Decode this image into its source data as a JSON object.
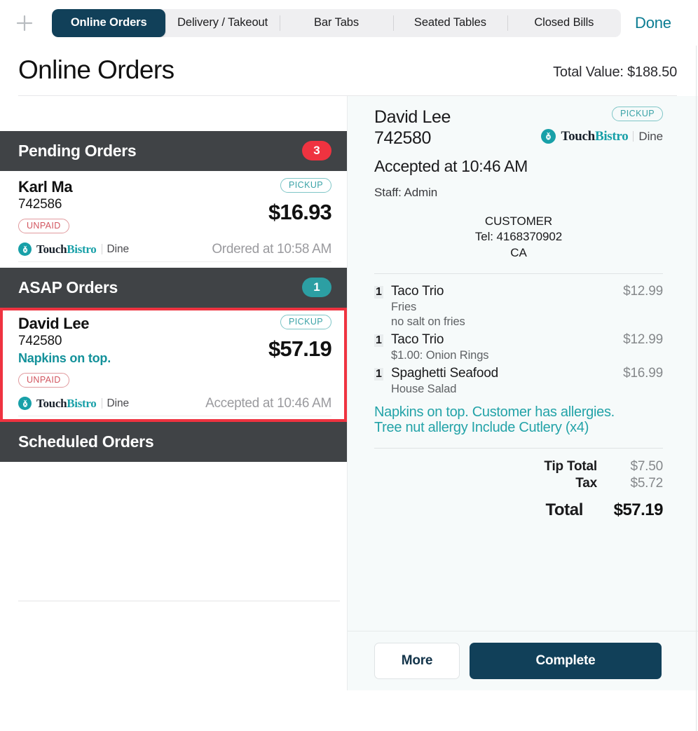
{
  "topbar": {
    "add_icon": "plus-icon",
    "tabs": [
      {
        "label": "Online Orders",
        "active": true
      },
      {
        "label": "Delivery / Takeout",
        "active": false
      },
      {
        "label": "Bar Tabs",
        "active": false
      },
      {
        "label": "Seated Tables",
        "active": false
      },
      {
        "label": "Closed Bills",
        "active": false
      }
    ],
    "done_label": "Done"
  },
  "header": {
    "title": "Online Orders",
    "total_value": "Total Value: $188.50"
  },
  "colors": {
    "accent_navy": "#114059",
    "accent_teal": "#13919a",
    "badge_red": "#ef3340",
    "badge_teal": "#2c9fa3",
    "group_header_bg": "#404346",
    "selection_outline": "#ef3340"
  },
  "left_panel": {
    "groups": [
      {
        "title": "Pending Orders",
        "count": "3",
        "badge_color": "#ef3340",
        "orders": [
          {
            "name": "Karl Ma",
            "number": "742586",
            "note": "",
            "type_badge": "PICKUP",
            "payment_badge": "UNPAID",
            "amount": "$16.93",
            "time": "Ordered at 10:58 AM",
            "brand_word_1": "Touch",
            "brand_word_2": "Bistro",
            "brand_sub": "Dine",
            "selected": false
          }
        ]
      },
      {
        "title": "ASAP Orders",
        "count": "1",
        "badge_color": "#2c9fa3",
        "orders": [
          {
            "name": "David Lee",
            "number": "742580",
            "note": "Napkins on top.",
            "type_badge": "PICKUP",
            "payment_badge": "UNPAID",
            "amount": "$57.19",
            "time": "Accepted at 10:46 AM",
            "brand_word_1": "Touch",
            "brand_word_2": "Bistro",
            "brand_sub": "Dine",
            "selected": true
          }
        ]
      },
      {
        "title": "Scheduled Orders",
        "count": "",
        "badge_color": "",
        "orders": []
      }
    ]
  },
  "receipt": {
    "name": "David Lee",
    "number": "742580",
    "accepted": "Accepted at 10:46 AM",
    "staff": "Staff: Admin",
    "type_badge": "PICKUP",
    "brand_word_1": "Touch",
    "brand_word_2": "Bistro",
    "brand_sub": "Dine",
    "customer_heading": "CUSTOMER",
    "customer_tel": "Tel: 4168370902",
    "customer_region": "CA",
    "items": [
      {
        "qty": "1",
        "name": "Taco Trio",
        "price": "$12.99",
        "mods": [
          "Fries",
          "no salt on fries"
        ]
      },
      {
        "qty": "1",
        "name": "Taco Trio",
        "price": "$12.99",
        "mods": [
          "$1.00: Onion Rings"
        ]
      },
      {
        "qty": "1",
        "name": "Spaghetti Seafood",
        "price": "$16.99",
        "mods": [
          "House Salad"
        ]
      }
    ],
    "note_line_1": "Napkins on top. Customer has allergies.",
    "note_line_2": "Tree nut allergy Include Cutlery (x4)",
    "totals": [
      {
        "label": "Tip Total",
        "value": "$7.50"
      },
      {
        "label": "Tax",
        "value": "$5.72"
      }
    ],
    "grand_total_label": "Total",
    "grand_total_value": "$57.19"
  },
  "actions": {
    "more_label": "More",
    "complete_label": "Complete"
  }
}
